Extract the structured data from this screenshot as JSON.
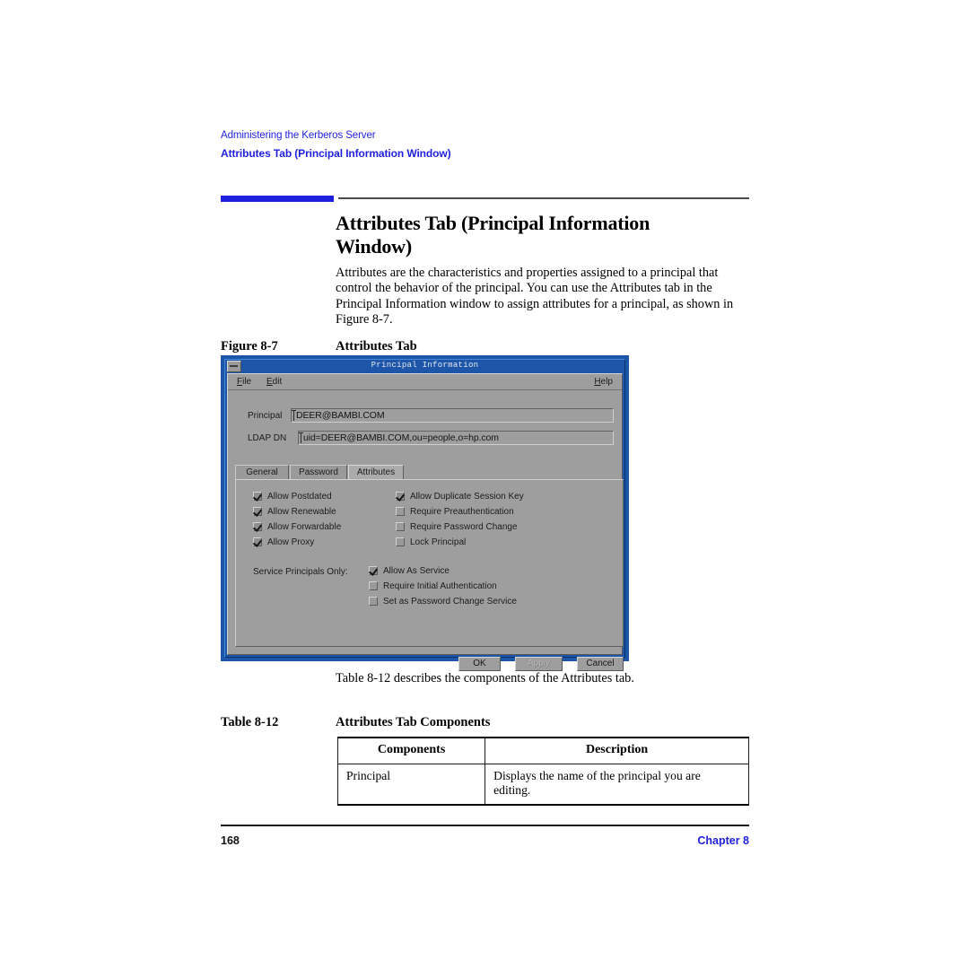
{
  "running_header": {
    "line1": "Administering the Kerberos Server",
    "line2": "Attributes Tab (Principal Information Window)",
    "color": "#1f1fe0"
  },
  "heading": {
    "title": "Attributes Tab (Principal Information Window)",
    "accent_color": "#1f1fe0",
    "rule_color": "#4a4a4a"
  },
  "body": {
    "paragraph": "Attributes are the characteristics and properties assigned to a principal that control the behavior of the principal. You can use the Attributes tab in the Principal Information window to assign attributes for a principal, as shown in Figure 8-7."
  },
  "figure": {
    "label": "Figure 8-7",
    "title": "Attributes Tab"
  },
  "dialog": {
    "title": "Principal Information",
    "titlebar_color": "#1d56a8",
    "face_color": "#9e9e9e",
    "menus": [
      {
        "label": "Help",
        "mnemonic": "H",
        "rest": "elp"
      },
      {
        "label": "File",
        "mnemonic": "F",
        "rest": "ile"
      },
      {
        "label": "Edit",
        "mnemonic": "E",
        "rest": "dit"
      }
    ],
    "menu_file": {
      "mnemonic": "F",
      "rest": "ile"
    },
    "menu_edit": {
      "mnemonic": "E",
      "rest": "dit"
    },
    "menu_help": {
      "mnemonic": "H",
      "rest": "elp"
    },
    "fields": [
      {
        "label": "Principal",
        "value": "DEER@BAMBI.COM"
      },
      {
        "label": "LDAP DN",
        "value": "uid=DEER@BAMBI.COM,ou=people,o=hp.com"
      }
    ],
    "tabs": [
      {
        "label": "General",
        "selected": false
      },
      {
        "label": "Password",
        "selected": false
      },
      {
        "label": "Attributes",
        "selected": true
      }
    ],
    "checkboxes_left": [
      {
        "label": "Allow Postdated",
        "checked": true
      },
      {
        "label": "Allow Renewable",
        "checked": true
      },
      {
        "label": "Allow Forwardable",
        "checked": true
      },
      {
        "label": "Allow Proxy",
        "checked": true
      }
    ],
    "checkboxes_right": [
      {
        "label": "Allow Duplicate Session Key",
        "checked": true
      },
      {
        "label": "Require Preauthentication",
        "checked": false
      },
      {
        "label": "Require Password Change",
        "checked": false
      },
      {
        "label": "Lock Principal",
        "checked": false
      }
    ],
    "service_section_label": "Service Principals Only:",
    "checkboxes_service": [
      {
        "label": "Allow As Service",
        "checked": true
      },
      {
        "label": "Require Initial Authentication",
        "checked": false
      },
      {
        "label": "Set as Password Change Service",
        "checked": false
      }
    ],
    "buttons": [
      {
        "label": "OK",
        "disabled": false
      },
      {
        "label": "Apply",
        "disabled": true
      },
      {
        "label": "Cancel",
        "disabled": false
      }
    ]
  },
  "after_figure": {
    "sentence": "Table 8-12 describes the components of the Attributes tab."
  },
  "table_block": {
    "label": "Table 8-12",
    "title": "Attributes Tab Components",
    "headers": [
      "Components",
      "Description"
    ],
    "rows": [
      {
        "component": "Principal",
        "description": "Displays the name of the principal you are editing."
      }
    ]
  },
  "footer": {
    "page_number": "168",
    "chapter": "Chapter 8",
    "chapter_color": "#1f1fe0"
  }
}
